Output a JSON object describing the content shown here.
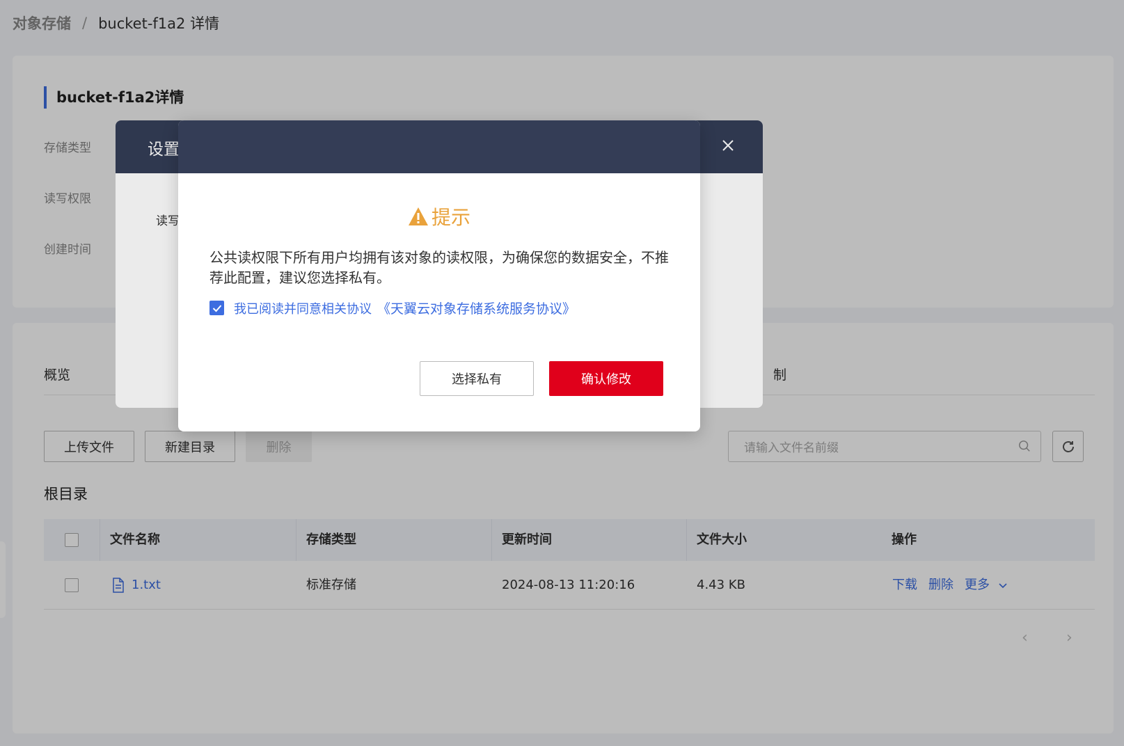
{
  "breadcrumb": {
    "root": "对象存储",
    "separator": "/",
    "current": "bucket-f1a2 详情"
  },
  "info": {
    "title": "bucket-f1a2详情",
    "labels": [
      "存储类型",
      "读写权限",
      "创建时间"
    ]
  },
  "tabs": {
    "overview": "概览",
    "partial_right": "制"
  },
  "toolbar": {
    "upload": "上传文件",
    "new_folder": "新建目录",
    "delete": "删除",
    "search_placeholder": "请输入文件名前缀"
  },
  "root_label": "根目录",
  "table": {
    "headers": [
      "文件名称",
      "存储类型",
      "更新时间",
      "文件大小",
      "操作"
    ],
    "rows": [
      {
        "name": "1.txt",
        "storage_type": "标准存储",
        "updated": "2024-08-13 11:20:16",
        "size": "4.43 KB",
        "actions": [
          "下载",
          "删除",
          "更多"
        ]
      }
    ]
  },
  "back_modal": {
    "title": "设置",
    "field_label_partial": "读写"
  },
  "dialog": {
    "title": "提示",
    "message": "公共读权限下所有用户均拥有该对象的读权限，为确保您的数据安全，不推荐此配置，建议您选择私有。",
    "agree_text": "我已阅读并同意相关协议",
    "agree_link": "《天翼云对象存储系统服务协议》",
    "btn_private": "选择私有",
    "btn_confirm": "确认修改"
  },
  "colors": {
    "accent": "#3d6de0",
    "danger": "#e0001b",
    "warning": "#e9a23b",
    "header_dark": "#343d56"
  }
}
